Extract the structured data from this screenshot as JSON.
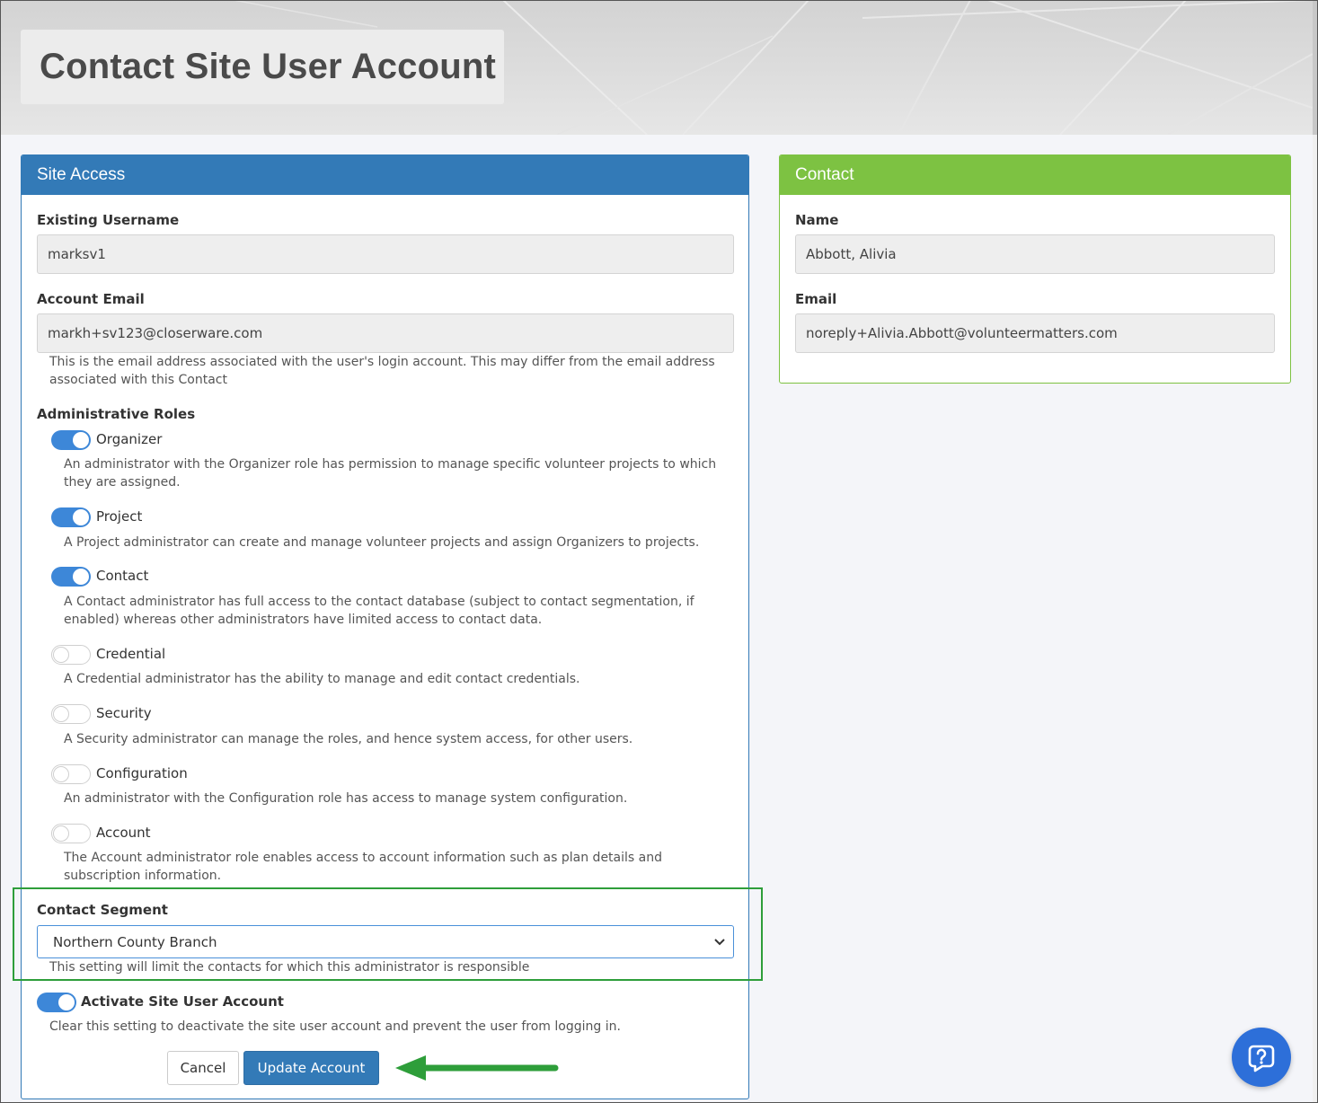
{
  "page": {
    "title": "Contact Site User Account"
  },
  "site_access": {
    "header": "Site Access",
    "existing_username": {
      "label": "Existing Username",
      "value": "marksv1"
    },
    "account_email": {
      "label": "Account Email",
      "value": "markh+sv123@closerware.com",
      "help": "This is the email address associated with the user's login account. This may differ from the email address associated with this Contact"
    },
    "roles_label": "Administrative Roles",
    "roles": [
      {
        "name": "Organizer",
        "enabled": true,
        "description": "An administrator with the Organizer role has permission to manage specific volunteer projects to which they are assigned."
      },
      {
        "name": "Project",
        "enabled": true,
        "description": "A Project administrator can create and manage volunteer projects and assign Organizers to projects."
      },
      {
        "name": "Contact",
        "enabled": true,
        "description": "A Contact administrator has full access to the contact database (subject to contact segmentation, if enabled) whereas other administrators have limited access to contact data."
      },
      {
        "name": "Credential",
        "enabled": false,
        "description": "A Credential administrator has the ability to manage and edit contact credentials."
      },
      {
        "name": "Security",
        "enabled": false,
        "description": "A Security administrator can manage the roles, and hence system access, for other users."
      },
      {
        "name": "Configuration",
        "enabled": false,
        "description": "An administrator with the Configuration role has access to manage system configuration."
      },
      {
        "name": "Account",
        "enabled": false,
        "description": "The Account administrator role enables access to account information such as plan details and subscription information."
      }
    ],
    "contact_segment": {
      "label": "Contact Segment",
      "selected": "Northern County Branch",
      "help": "This setting will limit the contacts for which this administrator is responsible"
    },
    "activate": {
      "label": "Activate Site User Account",
      "enabled": true,
      "help": "Clear this setting to deactivate the site user account and prevent the user from logging in."
    },
    "buttons": {
      "cancel": "Cancel",
      "update": "Update Account"
    }
  },
  "contact": {
    "header": "Contact",
    "name": {
      "label": "Name",
      "value": "Abbott, Alivia"
    },
    "email": {
      "label": "Email",
      "value": "noreply+Alivia.Abbott@volunteermatters.com"
    }
  },
  "colors": {
    "site_access_header": "#337ab7",
    "contact_header": "#7dc242",
    "toggle_on": "#3d87d8",
    "highlight": "#2e9e3a",
    "arrow": "#2e9e3a",
    "help_button": "#2d6fd9"
  },
  "icons": {
    "select_chevron": "chevron-down-icon",
    "help_fab": "help-chat-icon"
  }
}
